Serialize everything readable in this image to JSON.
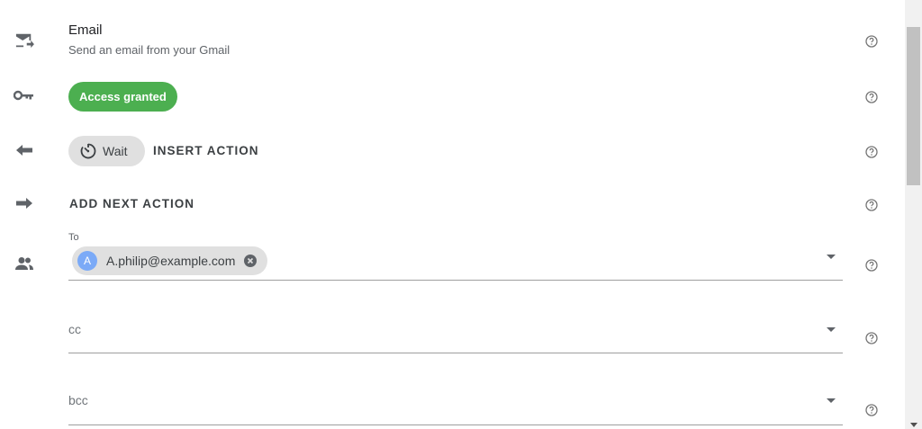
{
  "step": {
    "title": "Email",
    "subtitle": "Send an email from your Gmail",
    "icon": "email-forward-icon"
  },
  "account": {
    "status_label": "Access granted",
    "icon": "key-icon",
    "status_color": "#4caf50"
  },
  "previous_action": {
    "chip_label": "Wait",
    "insert_label": "INSERT ACTION",
    "icon": "arrow-left-icon"
  },
  "next_action": {
    "label": "ADD NEXT ACTION",
    "icon": "arrow-right-icon"
  },
  "recipients": {
    "to": {
      "label": "To",
      "chips": [
        {
          "avatar": "A",
          "email": "A.philip@example.com"
        }
      ]
    },
    "cc": {
      "placeholder": "cc"
    },
    "bcc": {
      "placeholder": "bcc"
    },
    "icon": "people-icon"
  }
}
